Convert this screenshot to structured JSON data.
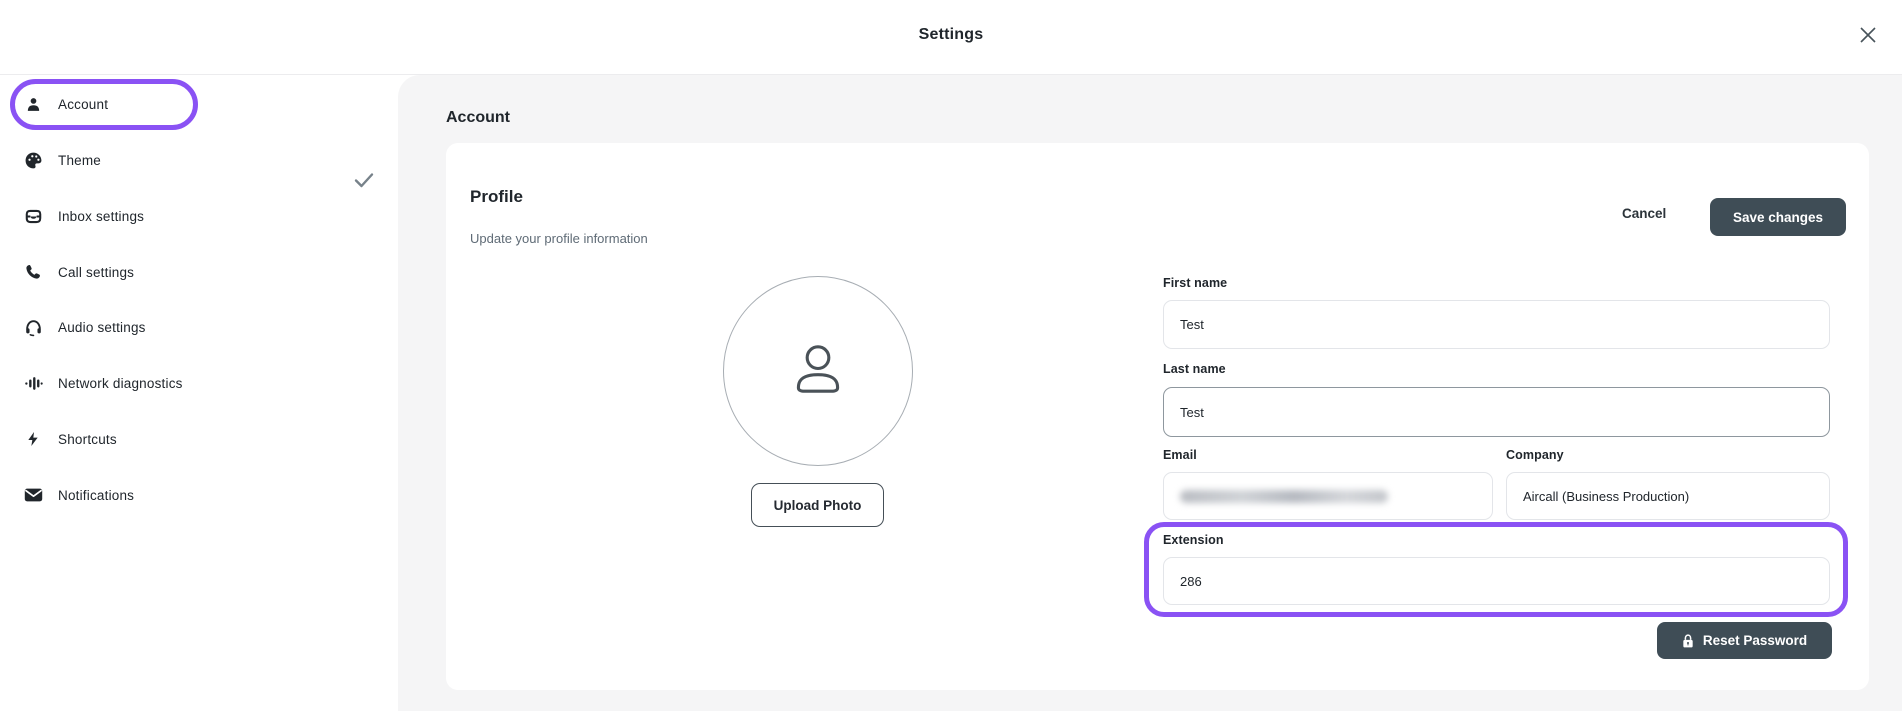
{
  "header": {
    "title": "Settings"
  },
  "sidebar": {
    "items": [
      {
        "label": "Account",
        "icon": "person-icon",
        "active": true,
        "saved_check": true
      },
      {
        "label": "Theme",
        "icon": "palette-icon"
      },
      {
        "label": "Inbox settings",
        "icon": "inbox-icon"
      },
      {
        "label": "Call settings",
        "icon": "phone-icon"
      },
      {
        "label": "Audio settings",
        "icon": "headphones-icon"
      },
      {
        "label": "Network diagnostics",
        "icon": "signal-bars-icon"
      },
      {
        "label": "Shortcuts",
        "icon": "lightning-icon"
      },
      {
        "label": "Notifications",
        "icon": "envelope-icon"
      }
    ]
  },
  "main": {
    "section_title": "Account",
    "profile": {
      "title": "Profile",
      "subtitle": "Update your profile information",
      "cancel_label": "Cancel",
      "save_label": "Save changes",
      "upload_photo_label": "Upload Photo",
      "reset_password_label": "Reset Password",
      "fields": {
        "first_name": {
          "label": "First name",
          "value": "Test"
        },
        "last_name": {
          "label": "Last name",
          "value": "Test"
        },
        "email": {
          "label": "Email",
          "redacted": true
        },
        "company": {
          "label": "Company",
          "value": "Aircall (Business Production)"
        },
        "extension": {
          "label": "Extension",
          "value": "286",
          "highlighted": true
        }
      }
    }
  },
  "colors": {
    "annotation_purple": "#8a52f4",
    "button_dark": "#3f4d56",
    "main_background": "#f5f5f6",
    "card_background": "#ffffff",
    "text_dark": "#20262c",
    "text_muted": "#5f6b76"
  }
}
